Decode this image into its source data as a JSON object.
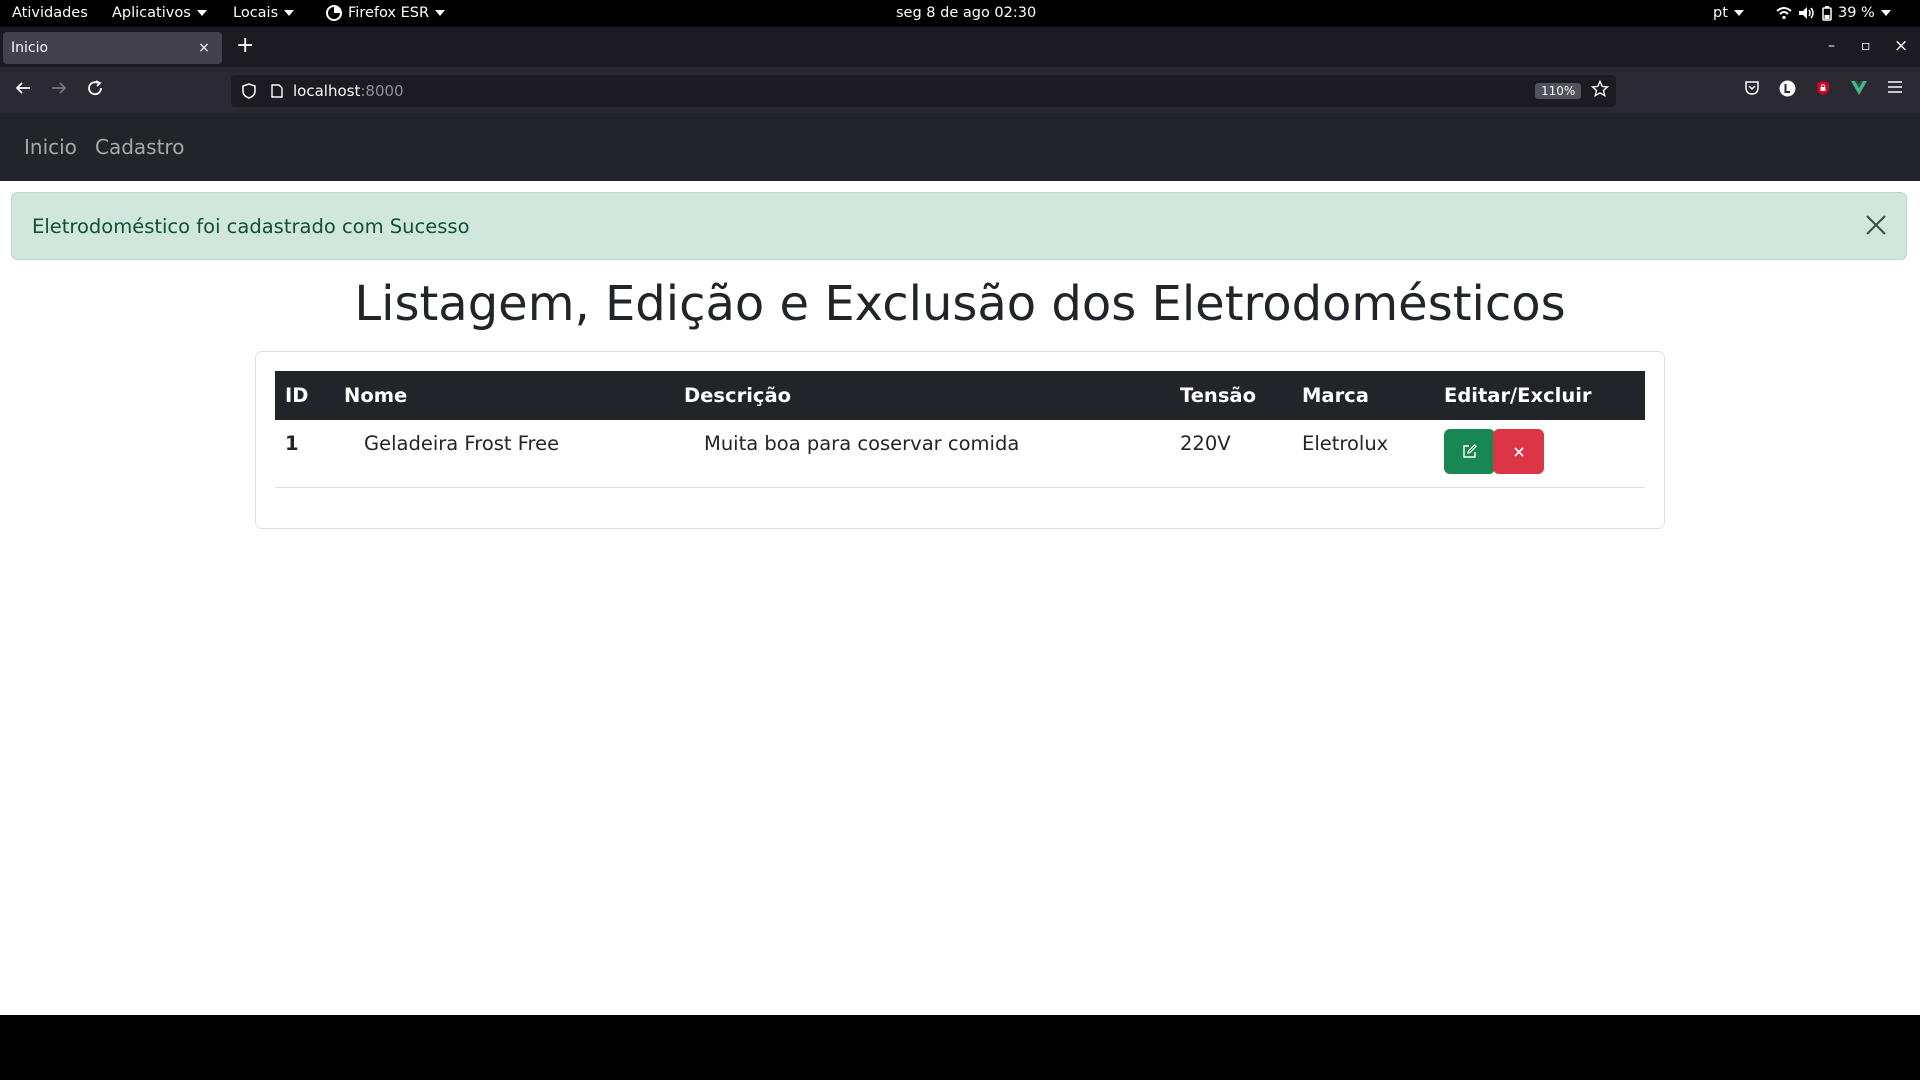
{
  "system_bar": {
    "activities": "Atividades",
    "apps": "Aplicativos",
    "places": "Locais",
    "browser": "Firefox ESR",
    "datetime": "seg 8 de ago  02:30",
    "lang": "pt",
    "battery": "39 %"
  },
  "browser": {
    "tab_title": "Inicio",
    "tab_close": "×",
    "new_tab": "+",
    "url_host": "localhost",
    "url_port": ":8000",
    "zoom": "110%",
    "win_min": "–",
    "win_max": "▫",
    "win_close": "×"
  },
  "site_nav": {
    "home": "Inicio",
    "register": "Cadastro"
  },
  "alert": {
    "message": "Eletrodoméstico foi cadastrado com Sucesso"
  },
  "page": {
    "title": "Listagem, Edição e Exclusão dos Eletrodomésticos"
  },
  "table": {
    "headers": {
      "id": "ID",
      "name": "Nome",
      "description": "Descrição",
      "voltage": "Tensão",
      "brand": "Marca",
      "actions": "Editar/Excluir"
    },
    "rows": [
      {
        "id": "1",
        "name": "Geladeira Frost Free",
        "description": "Muita boa para coservar comida",
        "voltage": "220V",
        "brand": "Eletrolux"
      }
    ]
  },
  "colors": {
    "success_bg": "#d1e7dd",
    "success_text": "#0f5132",
    "edit_button": "#198754",
    "delete_button": "#dc3545",
    "dark": "#212529"
  }
}
